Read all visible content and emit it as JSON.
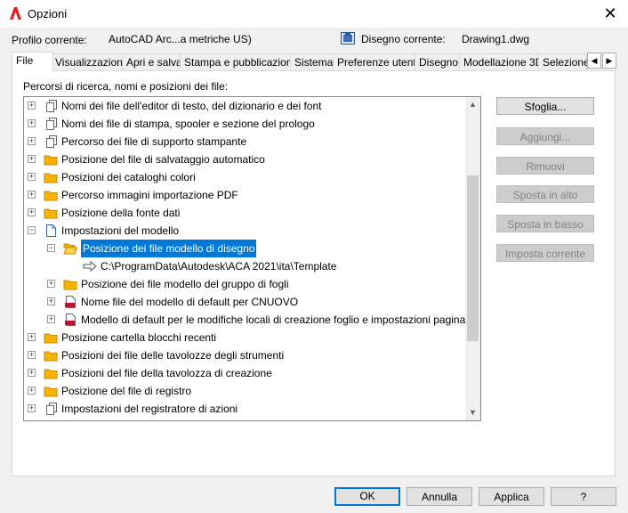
{
  "window": {
    "title": "Opzioni"
  },
  "profile": {
    "label": "Profilo corrente:",
    "value": "AutoCAD Arc...a metriche US)"
  },
  "drawing": {
    "label": "Disegno corrente:",
    "value": "Drawing1.dwg"
  },
  "tabs": [
    {
      "label": "File",
      "active": true
    },
    {
      "label": "Visualizzazione"
    },
    {
      "label": "Apri e salva"
    },
    {
      "label": "Stampa e pubblicazione"
    },
    {
      "label": "Sistema"
    },
    {
      "label": "Preferenze utente"
    },
    {
      "label": "Disegno"
    },
    {
      "label": "Modellazione 3D"
    },
    {
      "label": "Selezione"
    }
  ],
  "panel": {
    "label": "Percorsi di ricerca, nomi e posizioni dei file:"
  },
  "tree": [
    {
      "label": "Nomi dei file dell'editor di testo, del dizionario e dei font",
      "icon": "files-icon",
      "expander": "+"
    },
    {
      "label": "Nomi dei file di stampa, spooler e sezione del prologo",
      "icon": "files-icon",
      "expander": "+"
    },
    {
      "label": "Percorso dei file di supporto stampante",
      "icon": "files-icon",
      "expander": "+"
    },
    {
      "label": "Posizione del file di salvataggio automatico",
      "icon": "folder-icon",
      "expander": "+"
    },
    {
      "label": "Posizioni dei cataloghi colori",
      "icon": "folder-icon",
      "expander": "+"
    },
    {
      "label": "Percorso immagini importazione PDF",
      "icon": "folder-icon",
      "expander": "+"
    },
    {
      "label": "Posizione della fonte dati",
      "icon": "folder-icon",
      "expander": "+"
    },
    {
      "label": "Impostazioni del modello",
      "icon": "document-icon",
      "expander": "-"
    },
    {
      "label": "Posizione dei file modello di disegno",
      "icon": "open-folder-icon",
      "expander": "-",
      "selected": true
    },
    {
      "label": "C:\\ProgramData\\Autodesk\\ACA 2021\\ita\\Template",
      "icon": "path-arrow-icon"
    },
    {
      "label": "Posizione dei file modello del gruppo di fogli",
      "icon": "folder-icon",
      "expander": "+"
    },
    {
      "label": "Nome file del modello di default per CNUOVO",
      "icon": "dwt-file-icon",
      "expander": "+"
    },
    {
      "label": "Modello di default per le modifiche locali di creazione foglio e impostazioni pagina",
      "icon": "dwt-file-icon",
      "expander": "+"
    },
    {
      "label": "Posizione cartella blocchi recenti",
      "icon": "folder-icon",
      "expander": "+"
    },
    {
      "label": "Posizioni dei file delle tavolozze degli strumenti",
      "icon": "folder-icon",
      "expander": "+"
    },
    {
      "label": "Posizioni del file della tavolozza di creazione",
      "icon": "folder-icon",
      "expander": "+"
    },
    {
      "label": "Posizione del file di registro",
      "icon": "folder-icon",
      "expander": "+"
    },
    {
      "label": "Impostazioni del registratore di azioni",
      "icon": "files-icon",
      "expander": "+"
    }
  ],
  "side_buttons": {
    "browse": "Sfoglia...",
    "add": "Aggiungi...",
    "remove": "Rimuovi",
    "move_up": "Sposta in alto",
    "move_down": "Sposta in basso",
    "set_current": "Imposta corrente"
  },
  "footer": {
    "ok": "OK",
    "cancel": "Annulla",
    "apply": "Applica",
    "help": "?"
  }
}
